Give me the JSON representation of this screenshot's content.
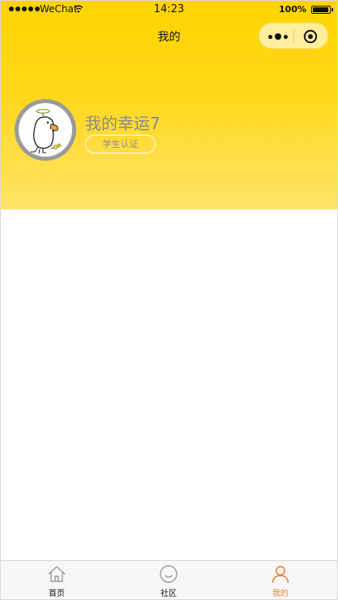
{
  "status_bar": {
    "carrier": "WeChat",
    "time": "14:23",
    "battery": "100%"
  },
  "nav": {
    "title": "我的"
  },
  "profile": {
    "username": "我的幸运7",
    "verify_label": "学生认证"
  },
  "tabbar": {
    "tabs": [
      {
        "label": "首页",
        "icon": "home-icon",
        "active": false
      },
      {
        "label": "社区",
        "icon": "smile-icon",
        "active": false
      },
      {
        "label": "我的",
        "icon": "user-icon",
        "active": true
      }
    ],
    "active_color": "#e8833a"
  },
  "colors": {
    "header_top": "#ffd400",
    "header_bottom": "#ffe36a"
  }
}
